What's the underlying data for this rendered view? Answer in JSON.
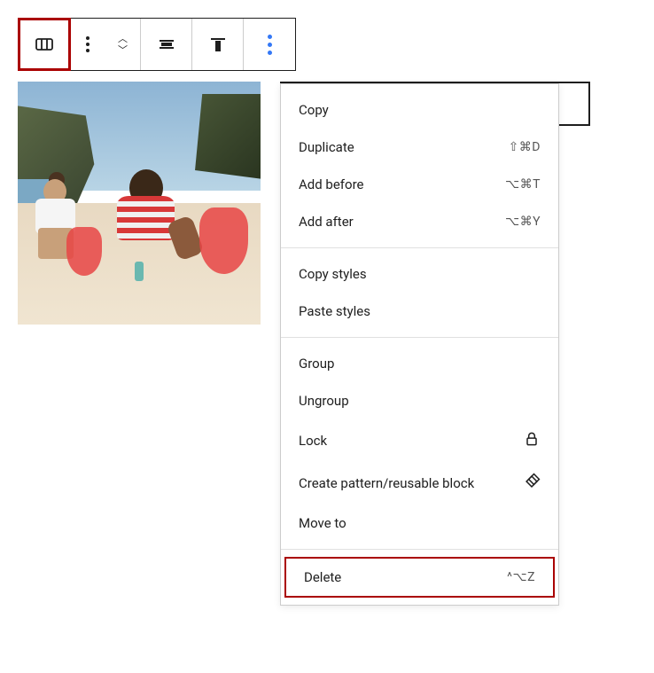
{
  "toolbar": {
    "columns_icon": "columns",
    "drag_icon": "drag-handle",
    "move_icon": "move",
    "justify_icon": "justify",
    "align_icon": "align-top",
    "options_icon": "more-options"
  },
  "menu": {
    "section1": [
      {
        "label": "Copy",
        "shortcut": ""
      },
      {
        "label": "Duplicate",
        "shortcut": "⇧⌘D"
      },
      {
        "label": "Add before",
        "shortcut": "⌥⌘T"
      },
      {
        "label": "Add after",
        "shortcut": "⌥⌘Y"
      }
    ],
    "section2": [
      {
        "label": "Copy styles",
        "shortcut": ""
      },
      {
        "label": "Paste styles",
        "shortcut": ""
      }
    ],
    "section3": [
      {
        "label": "Group",
        "shortcut": "",
        "icon": ""
      },
      {
        "label": "Ungroup",
        "shortcut": "",
        "icon": ""
      },
      {
        "label": "Lock",
        "shortcut": "",
        "icon": "lock"
      },
      {
        "label": "Create pattern/reusable block",
        "shortcut": "",
        "icon": "diamond"
      },
      {
        "label": "Move to",
        "shortcut": "",
        "icon": ""
      }
    ],
    "section4": [
      {
        "label": "Delete",
        "shortcut": "^⌥Z"
      }
    ]
  }
}
